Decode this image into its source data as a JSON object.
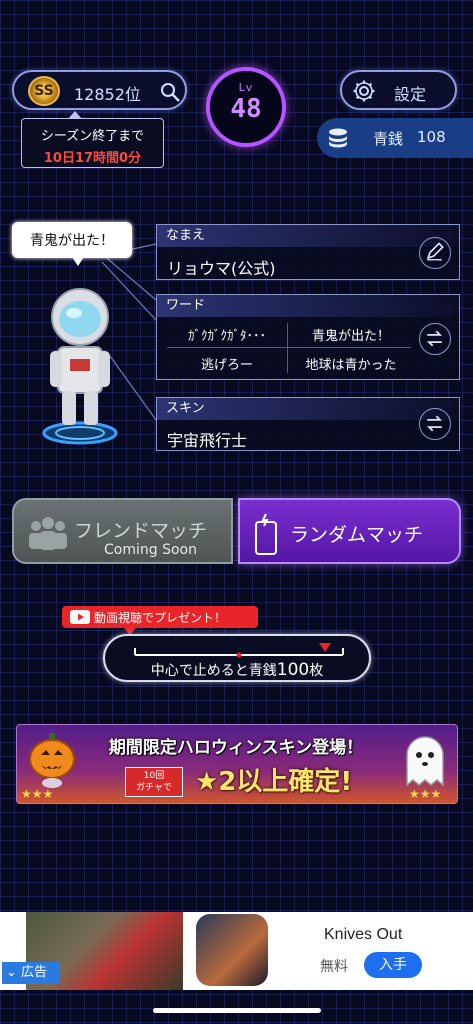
{
  "header": {
    "rank_badge": "SS",
    "rank_text": "12852位",
    "season_label": "シーズン終了まで",
    "season_time": "10日17時間0分",
    "level_label": "Lv",
    "level_value": "48",
    "settings_label": "設定",
    "currency_label": "青銭",
    "currency_value": "108"
  },
  "profile": {
    "speech": "青鬼が出た！",
    "name_label": "なまえ",
    "name_value": "リョウマ(公式)",
    "word_label": "ワード",
    "words": [
      "ｶﾞｸｶﾞｸｶﾞﾀ･･･",
      "青鬼が出た！",
      "逃げろー",
      "地球は青かった"
    ],
    "skin_label": "スキン",
    "skin_value": "宇宙飛行士"
  },
  "match": {
    "friend_label": "フレンドマッチ",
    "friend_sub": "Coming Soon",
    "random_label": "ランダムマッチ"
  },
  "present": {
    "tag": "動画視聴でプレゼント！",
    "gauge_text_pre": "中心で止めると青銭",
    "gauge_amount": "100",
    "gauge_unit": "枚"
  },
  "banner": {
    "title": "期間限定ハロウィンスキン登場！",
    "gacha": "10回\nガチャで",
    "star_text": "★2以上確定!"
  },
  "ad": {
    "label": "広告",
    "title": "Knives Out",
    "free": "無料",
    "install": "入手"
  },
  "colors": {
    "accent_purple": "#b455ff",
    "currency_bar": "#1a3e86",
    "season_red": "#ff4a3a"
  }
}
